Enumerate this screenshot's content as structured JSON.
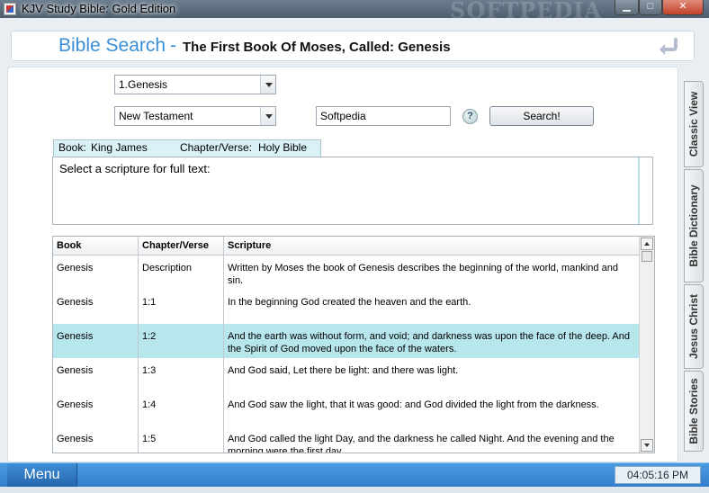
{
  "window": {
    "title": "KJV Study Bible: Gold Edition",
    "watermark": "SOFTPEDIA",
    "min_glyph": "▁",
    "max_glyph": "□",
    "close_glyph": "✕"
  },
  "header": {
    "title": "Bible Search",
    "dash": "-",
    "subtitle": "The First Book Of Moses, Called: Genesis"
  },
  "controls": {
    "book_select": "1.Genesis",
    "testament_select": "New Testament",
    "search_value": "Softpedia",
    "help_label": "?",
    "search_button": "Search!"
  },
  "info": {
    "book_label": "Book:",
    "book_value": "King James",
    "chapter_label": "Chapter/Verse:",
    "chapter_value": "Holy Bible",
    "placeholder": "Select a scripture for full text:"
  },
  "table": {
    "columns": [
      "Book",
      "Chapter/Verse",
      "Scripture"
    ],
    "rows": [
      {
        "book": "Genesis",
        "chapter": "Description",
        "text": "Written by Moses the book of Genesis describes the beginning of the world, mankind and sin."
      },
      {
        "book": "Genesis",
        "chapter": "1:1",
        "text": "In the beginning God created the heaven and the earth."
      },
      {
        "book": "Genesis",
        "chapter": "1:2",
        "text": "And the earth was without form, and void; and darkness was upon the face of the deep. And the Spirit of God moved upon the face of the waters."
      },
      {
        "book": "Genesis",
        "chapter": "1:3",
        "text": "And God said, Let there be light: and there was light."
      },
      {
        "book": "Genesis",
        "chapter": "1:4",
        "text": "And God saw the light, that it was good: and God divided the light from the darkness."
      },
      {
        "book": "Genesis",
        "chapter": "1:5",
        "text": "And God called the light Day, and the darkness he called Night. And the evening and the morning were the first day."
      }
    ]
  },
  "sidetabs": [
    "Classic View",
    "Bible Dictionary",
    "Jesus Christ",
    "Bible Stories"
  ],
  "footer": {
    "menu_label": "Menu",
    "clock": "04:05:16 PM"
  },
  "colors": {
    "accent": "#3a8fd6",
    "selected_row": "#b8e6ed",
    "bottom_bar": "#2b77c6"
  }
}
